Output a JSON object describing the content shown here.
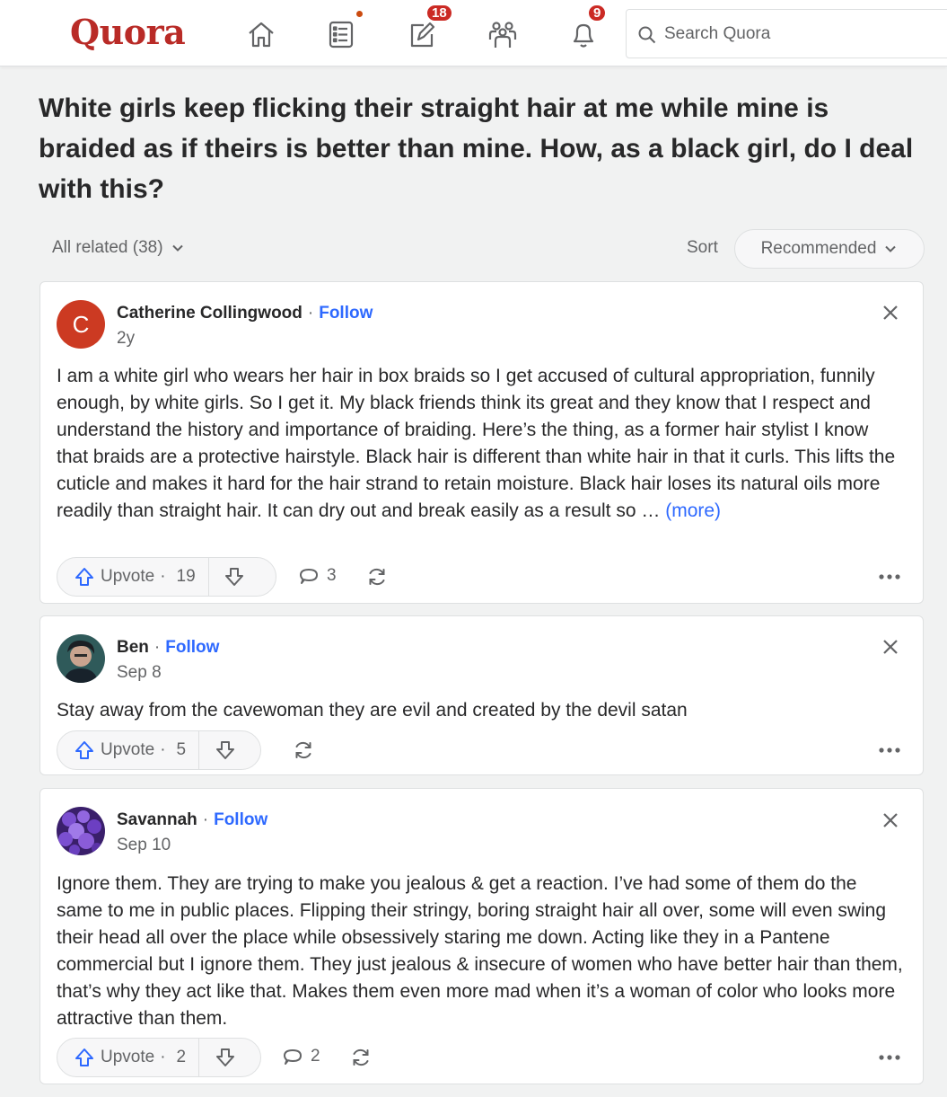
{
  "header": {
    "logo": "Quora",
    "badges": {
      "answer": "18",
      "notifications": "9"
    },
    "search_placeholder": "Search Quora"
  },
  "question": {
    "title": "White girls keep flicking their straight hair at me while mine is braided as if theirs is better than mine. How, as a black girl, do I deal with this?"
  },
  "filters": {
    "all_related": "All related (38)",
    "sort_label": "Sort",
    "sort_value": "Recommended"
  },
  "answers": [
    {
      "avatar_letter": "C",
      "author": "Catherine Collingwood",
      "separator": "·",
      "follow": "Follow",
      "date": "2y",
      "text": "I am a white girl who wears her hair in box braids so I get accused of cultural appropriation, funnily enough, by white girls. So I get it. My black friends think its great and they know that I respect and understand the history and importance of braiding. Here’s the thing, as a former hair stylist I know that braids are a protective hairstyle. Black hair is different than white hair in that it curls. This lifts the cuticle and makes it hard for the hair strand to retain moisture. Black hair loses its natural oils more readily than straight hair. It can dry out and break easily as a result so …",
      "more": "(more)",
      "upvote_label": "Upvote",
      "upvotes": "19",
      "comments": "3"
    },
    {
      "author": "Ben",
      "separator": "·",
      "follow": "Follow",
      "date": "Sep 8",
      "text": "Stay away from the cavewoman they are evil and created by the devil satan",
      "upvote_label": "Upvote",
      "upvotes": "5"
    },
    {
      "author": "Savannah",
      "separator": "·",
      "follow": "Follow",
      "date": "Sep 10",
      "text": "Ignore them. They are trying to make you jealous & get a reaction. I’ve had some of them do the same to me in public places. Flipping their stringy, boring straight hair all over, some will even swing their head all over the place while obsessively staring me down. Acting like they in a Pantene commercial but I ignore them. They just jealous & insecure of women who have better hair than them, that’s why they act like that. Makes them even more mad when it’s a woman of color who looks more attractive than them.",
      "upvote_label": "Upvote",
      "upvotes": "2",
      "comments": "2"
    }
  ],
  "colors": {
    "brand": "#b92b27",
    "link": "#2e69ff",
    "upvote_icon": "#2e69ff",
    "badge": "#cb2a24"
  }
}
